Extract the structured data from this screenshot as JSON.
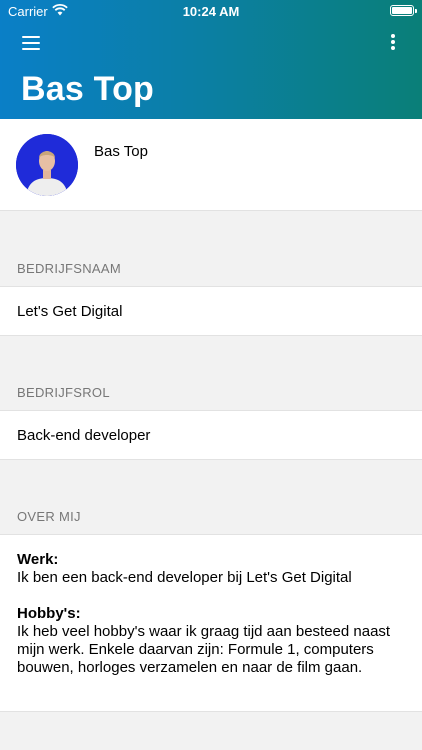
{
  "status_bar": {
    "carrier": "Carrier",
    "time": "10:24 AM"
  },
  "header": {
    "title": "Bas Top"
  },
  "profile": {
    "name": "Bas Top"
  },
  "sections": {
    "company": {
      "label": "BEDRIJFSNAAM",
      "value": "Let's Get Digital"
    },
    "role": {
      "label": "BEDRIJFSROL",
      "value": "Back-end developer"
    },
    "about": {
      "label": "OVER MIJ",
      "work_heading": "Werk:",
      "work_text": "Ik ben een back-end developer bij Let's Get Digital",
      "hobby_heading": "Hobby's:",
      "hobby_text": "Ik heb veel hobby's waar ik graag tijd aan besteed naast mijn werk. Enkele daarvan zijn: Formule 1, computers bouwen, horloges verzamelen en naar de film gaan."
    }
  },
  "colors": {
    "header_gradient_start": "#0a7fc7",
    "header_gradient_end": "#0a7f78",
    "avatar_bg": "#1f2bd9"
  },
  "icons": {
    "menu": "hamburger-menu-icon",
    "more": "more-vertical-icon",
    "wifi": "wifi-icon",
    "battery": "battery-icon"
  }
}
